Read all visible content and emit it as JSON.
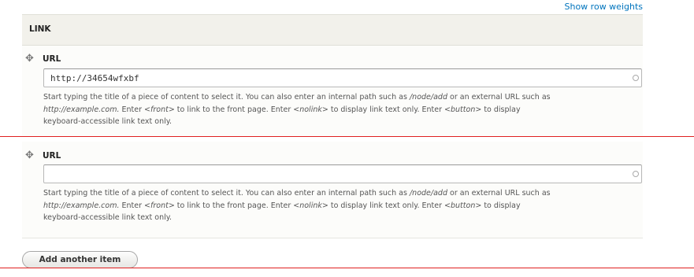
{
  "show_row_weights": "Show row weights",
  "section_title": "LINK",
  "items": [
    {
      "label": "URL",
      "value": "http://34654wfxbf",
      "desc": {
        "t1": "Start typing the title of a piece of content to select it. You can also enter an internal path such as ",
        "e1": "/node/add",
        "t2": " or an external URL such as",
        "e2": "http://example.com.",
        "t3": " Enter ",
        "e3": "<front>",
        "t4": " to link to the front page. Enter ",
        "e4": "<nolink>",
        "t5": " to display link text only. Enter ",
        "e5": "<button>",
        "t6": " to display",
        "t7": "keyboard-accessible link text only."
      }
    },
    {
      "label": "URL",
      "value": "",
      "desc": {
        "t1": "Start typing the title of a piece of content to select it. You can also enter an internal path such as ",
        "e1": "/node/add",
        "t2": " or an external URL such as",
        "e2": "http://example.com.",
        "t3": " Enter ",
        "e3": "<front>",
        "t4": " to link to the front page. Enter ",
        "e4": "<nolink>",
        "t5": " to display link text only. Enter ",
        "e5": "<button>",
        "t6": " to display",
        "t7": "keyboard-accessible link text only."
      }
    }
  ],
  "add_another_label": "Add another item",
  "colors": {
    "link": "#0074bd",
    "divider": "#e02020",
    "header_bg": "#f2f1eb"
  },
  "icons": {
    "drag_handle": "drag-handle-icon",
    "autocomplete": "autocomplete-throbber-icon"
  }
}
